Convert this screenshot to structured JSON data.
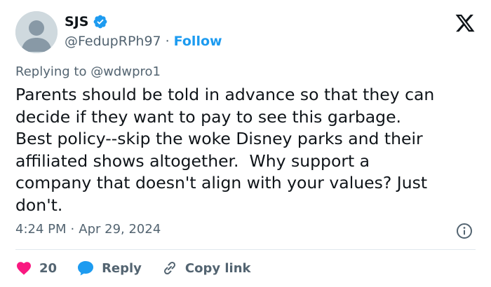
{
  "author": {
    "display_name": "SJS",
    "handle": "@FedupRPh97",
    "separator": "·",
    "follow_label": "Follow",
    "verified": true
  },
  "reply_context": {
    "prefix": "Replying to ",
    "mention": "@wdwpro1"
  },
  "tweet": {
    "text": "Parents should be told in advance so that they can\ndecide if they want to pay to see this garbage.\nBest policy--skip the woke Disney parks and their\naffiliated shows altogether.  Why support a\ncompany that doesn't align with your values? Just\ndon't.",
    "time": "4:24 PM",
    "separator": "·",
    "date": "Apr 29, 2024"
  },
  "actions": {
    "like_count": "20",
    "reply_label": "Reply",
    "copy_link_label": "Copy link"
  },
  "colors": {
    "accent": "#1d9bf0",
    "like": "#f91880",
    "muted": "#536471",
    "text": "#0f1419"
  },
  "icons": [
    "verified-badge-icon",
    "x-logo-icon",
    "info-icon",
    "heart-icon",
    "reply-bubble-icon",
    "link-icon"
  ]
}
